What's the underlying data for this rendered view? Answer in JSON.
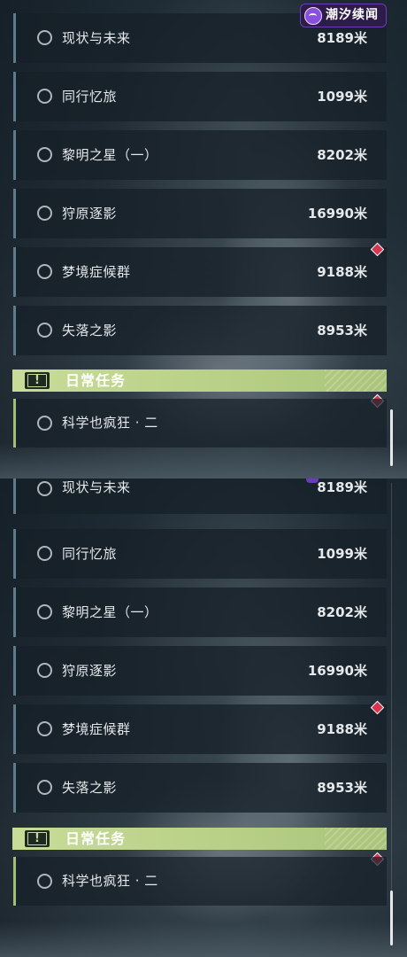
{
  "logo": {
    "text": "潮汐续闻"
  },
  "panels": [
    {
      "quests": [
        {
          "name": "现状与未来",
          "distance": "8189米"
        },
        {
          "name": "同行忆旅",
          "distance": "1099米"
        },
        {
          "name": "黎明之星（一）",
          "distance": "8202米"
        },
        {
          "name": "狩原逐影",
          "distance": "16990米"
        },
        {
          "name": "梦境症候群",
          "distance": "9188米"
        },
        {
          "name": "失落之影",
          "distance": "8953米"
        }
      ],
      "daily": {
        "header": "日常任务",
        "alert_symbol": "!",
        "item": "科学也疯狂 · 二"
      }
    },
    {
      "quests": [
        {
          "name": "现状与未来",
          "distance": "8189米"
        },
        {
          "name": "同行忆旅",
          "distance": "1099米"
        },
        {
          "name": "黎明之星（一）",
          "distance": "8202米"
        },
        {
          "name": "狩原逐影",
          "distance": "16990米"
        },
        {
          "name": "梦境症候群",
          "distance": "9188米"
        },
        {
          "name": "失落之影",
          "distance": "8953米"
        }
      ],
      "daily": {
        "header": "日常任务",
        "alert_symbol": "!",
        "item": "科学也疯狂 · 二"
      }
    }
  ],
  "colors": {
    "daily_accent": "#c8dc98",
    "marker": "#d8364e",
    "logo_bg": "#2d1b4a"
  }
}
